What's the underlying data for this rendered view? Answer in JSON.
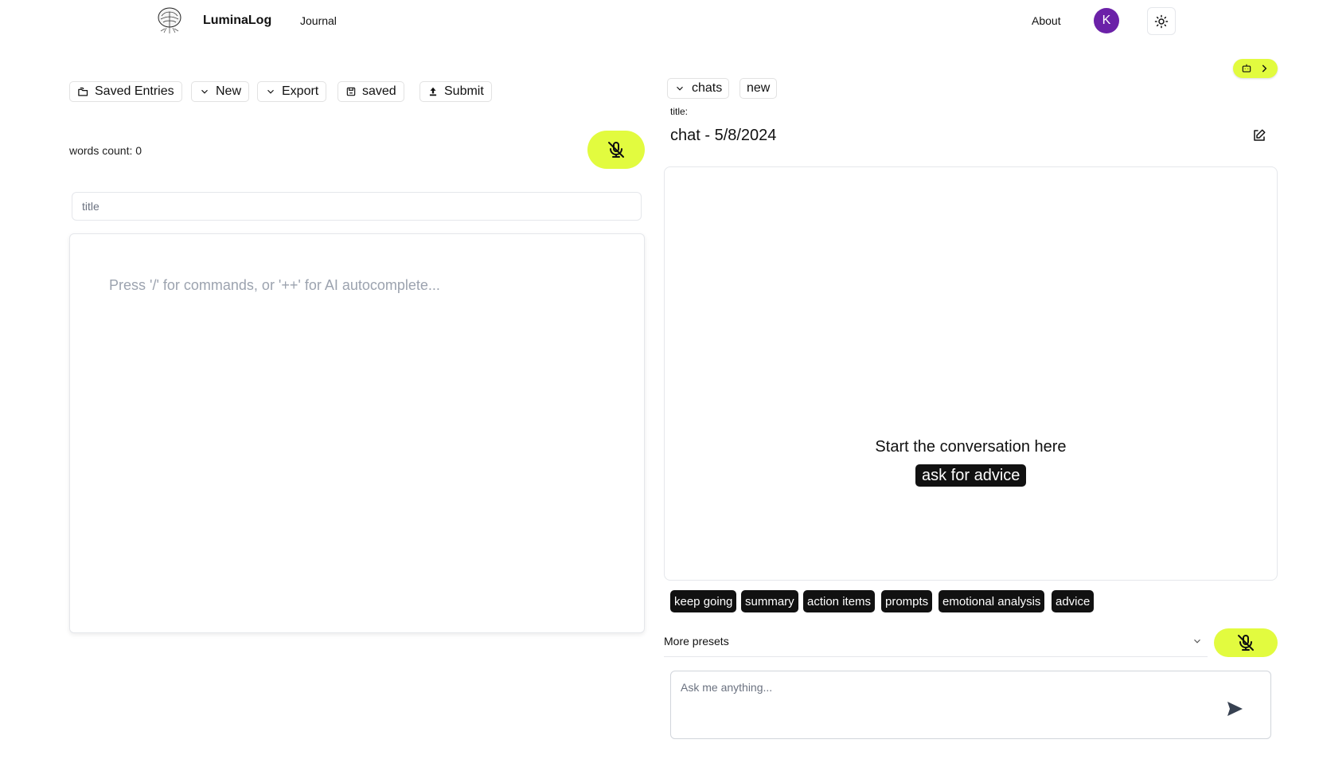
{
  "header": {
    "brand": "LuminaLog",
    "nav": {
      "journal": "Journal",
      "about": "About"
    },
    "avatar_initial": "K"
  },
  "toolbar": {
    "saved_entries": "Saved Entries",
    "new": "New",
    "export": "Export",
    "saved": "saved",
    "submit": "Submit"
  },
  "editor": {
    "words_count": "words count: 0",
    "title_placeholder": "title",
    "body_placeholder": "Press '/' for commands, or '++' for AI autocomplete..."
  },
  "chat": {
    "chats_label": "chats",
    "new_label": "new",
    "title_label": "title:",
    "title_value": "chat - 5/8/2024",
    "empty_text": "Start the conversation here",
    "ask_advice": "ask for advice",
    "chips": [
      "keep going",
      "summary",
      "action items",
      "prompts",
      "emotional analysis",
      "advice"
    ],
    "presets_label": "More presets",
    "input_placeholder": "Ask me anything..."
  },
  "colors": {
    "accent": "#e2fb3f",
    "avatar": "#6b21a8",
    "chip_bg": "#111111"
  },
  "icons": [
    "logo-tree-icon",
    "sun-icon",
    "folder-icon",
    "chevron-down-icon",
    "save-disk-icon",
    "upload-icon",
    "mic-off-icon",
    "bot-icon",
    "chevron-right-icon",
    "edit-icon",
    "send-icon"
  ]
}
